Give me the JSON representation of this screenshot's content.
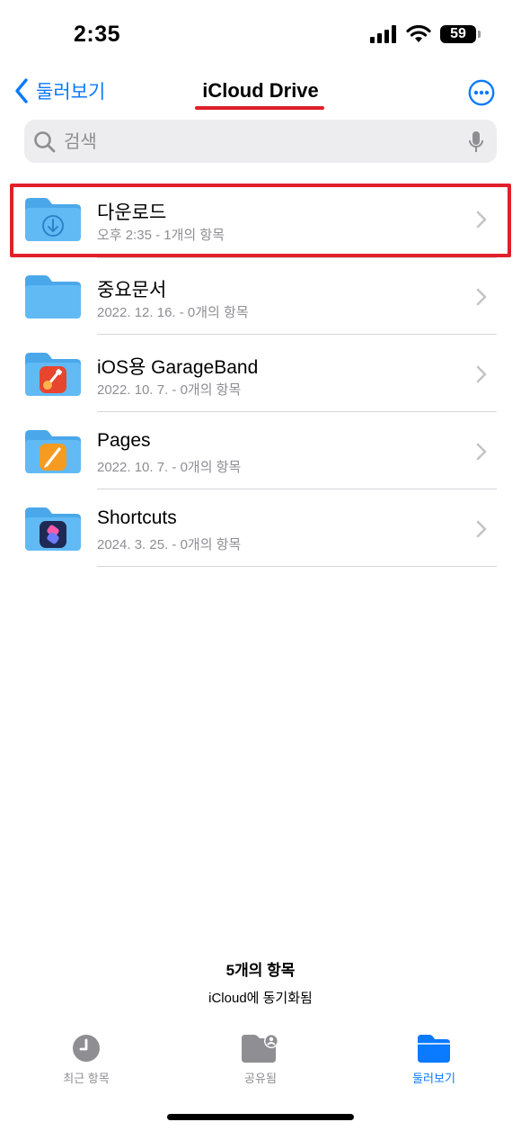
{
  "status_bar": {
    "time": "2:35",
    "battery": "59"
  },
  "nav": {
    "back_label": "둘러보기",
    "title": "iCloud Drive"
  },
  "search": {
    "placeholder": "검색"
  },
  "items": [
    {
      "name": "다운로드",
      "meta": "오후 2:35 - 1개의 항목",
      "icon": "download-folder-icon"
    },
    {
      "name": "중요문서",
      "meta": "2022. 12. 16. - 0개의 항목",
      "icon": "folder-icon"
    },
    {
      "name": "iOS용 GarageBand",
      "meta": "2022. 10. 7. - 0개의 항목",
      "icon": "garageband-folder-icon"
    },
    {
      "name": "Pages",
      "meta": "2022. 10. 7. - 0개의 항목",
      "icon": "pages-folder-icon"
    },
    {
      "name": "Shortcuts",
      "meta": "2024. 3. 25. - 0개의 항목",
      "icon": "shortcuts-folder-icon"
    }
  ],
  "footer": {
    "count": "5개의 항목",
    "sync": "iCloud에 동기화됨"
  },
  "tabs": [
    {
      "label": "최근 항목",
      "icon": "clock-icon"
    },
    {
      "label": "공유됨",
      "icon": "shared-folder-icon"
    },
    {
      "label": "둘러보기",
      "icon": "browse-folder-icon",
      "active": true
    }
  ],
  "colors": {
    "accent": "#0a7aff",
    "annotation": "#e0202a",
    "folder": "#5ab5f2"
  }
}
